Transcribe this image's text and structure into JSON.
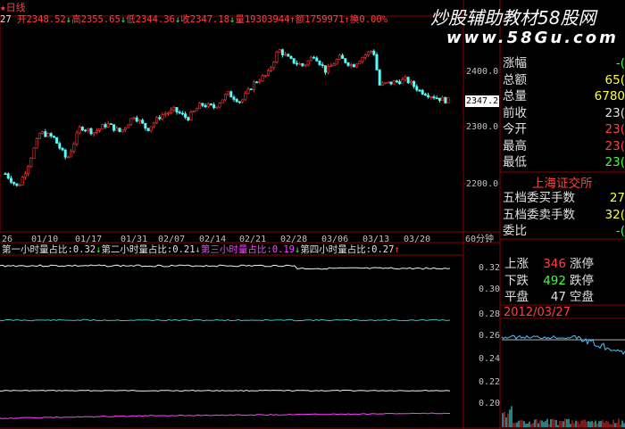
{
  "colors": {
    "up": "#ff3232",
    "down": "#54fcfc",
    "grid": "#8b0000",
    "white": "#f0f0f0",
    "cyan": "#40c0c0",
    "magenta": "#ff40ff"
  },
  "topbar": {
    "title_icon": "star-icon",
    "chart_name": "日线",
    "open": "开2348.52",
    "high": "高2355.65",
    "low": "低2344.36",
    "close": "收2347.18",
    "volume": "量19303944",
    "amount": "额1759971",
    "turnover": "换0.00%",
    "prefix": "27"
  },
  "watermark": {
    "line1": "炒股辅助教材58股网",
    "line2": "www.58Gu.com"
  },
  "price_axis": {
    "labels": [
      "2400.0",
      "2300.0",
      "2200.0"
    ],
    "current": "2347.2"
  },
  "date_axis": {
    "labels": [
      "26",
      "01/10",
      "01/17",
      "01/31",
      "02/07",
      "02/14",
      "02/21",
      "02/28",
      "03/06",
      "03/13",
      "03/20"
    ],
    "period": "60分钟"
  },
  "indicator": {
    "items": [
      {
        "label": "第一小时量占比:0.32",
        "arrow": "↓"
      },
      {
        "label": "第二小时量占比:0.21",
        "arrow": "↓"
      },
      {
        "label": "第三小时量占比:0.19",
        "arrow": "↓"
      },
      {
        "label": "第四小时量占比:0.27",
        "arrow": "↑"
      }
    ],
    "axis_labels": [
      "0.32",
      "0.30",
      "0.28",
      "0.26",
      "0.24",
      "0.22",
      "0.20"
    ]
  },
  "quote_panel": {
    "rows": [
      {
        "label": "涨幅",
        "value": "-("
      },
      {
        "label": "总额",
        "value": "65("
      },
      {
        "label": "总量",
        "value": "6780"
      },
      {
        "label": "前收",
        "value": "23("
      },
      {
        "label": "今开",
        "value": "23("
      },
      {
        "label": "最高",
        "value": "23("
      },
      {
        "label": "最低",
        "value": "23("
      }
    ],
    "exchange": "上海证交所",
    "order_rows": [
      {
        "label": "五档委买手数",
        "value": "27"
      },
      {
        "label": "五档委卖手数",
        "value": "32("
      },
      {
        "label": "委比",
        "value": "-("
      }
    ],
    "breadth": [
      {
        "label": "上涨",
        "value": "346",
        "label2": "涨停"
      },
      {
        "label": "下跌",
        "value": "492",
        "label2": "跌停"
      },
      {
        "label": "平盘",
        "value": "47",
        "label2": "空盘"
      }
    ],
    "mini_date": "2012/03/27"
  }
}
